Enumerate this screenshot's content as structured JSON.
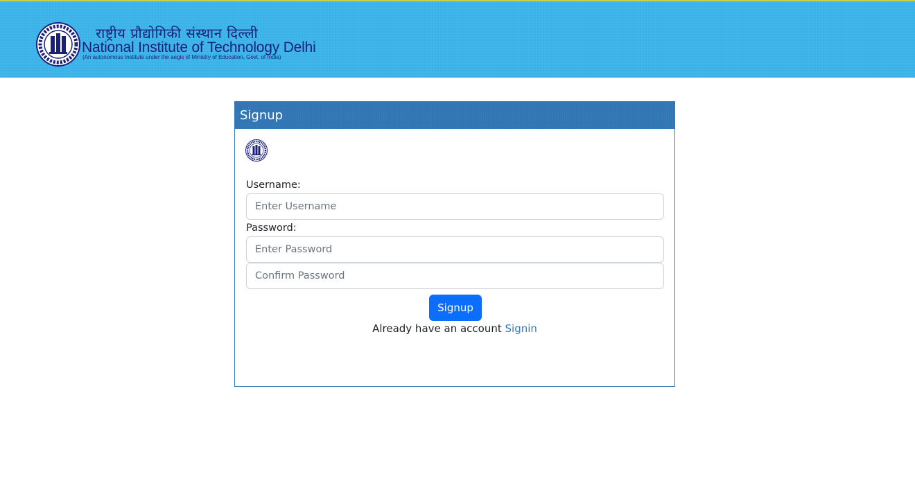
{
  "header": {
    "hindi_title": "राष्ट्रीय प्रौद्योगिकी संस्थान दिल्ली",
    "institute_name": "National Institute of Technology Delhi",
    "subtitle": "(An autonomous Institute under the aegis of Ministry of Education, Govt. of India)",
    "logo_icon": "nit-delhi-seal-icon"
  },
  "form": {
    "title": "Signup",
    "logo_icon": "nit-delhi-seal-icon",
    "username_label": "Username:",
    "username_placeholder": "Enter Username",
    "password_label": "Password:",
    "password_placeholder": "Enter Password",
    "confirm_placeholder": "Confirm Password",
    "submit_label": "Signup",
    "signin_prompt": "Already have an account",
    "signin_link": "Signin"
  },
  "colors": {
    "banner": "#3bb3e8",
    "card_header": "#2f74b3",
    "button": "#0d6efd",
    "link": "#337ab7",
    "brand_text": "#1a1f7a"
  }
}
